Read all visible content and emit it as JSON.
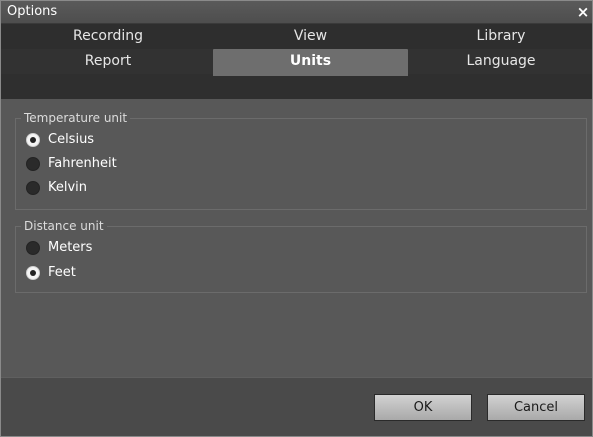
{
  "window": {
    "title": "Options",
    "close_glyph": "×"
  },
  "tabs": {
    "row1": [
      {
        "label": "Recording",
        "active": false
      },
      {
        "label": "View",
        "active": false
      },
      {
        "label": "Library",
        "active": false
      }
    ],
    "row2": [
      {
        "label": "Report",
        "active": false
      },
      {
        "label": "Units",
        "active": true
      },
      {
        "label": "Language",
        "active": false
      }
    ]
  },
  "temperature": {
    "legend": "Temperature unit",
    "options": [
      {
        "label": "Celsius",
        "checked": true
      },
      {
        "label": "Fahrenheit",
        "checked": false
      },
      {
        "label": "Kelvin",
        "checked": false
      }
    ]
  },
  "distance": {
    "legend": "Distance unit",
    "options": [
      {
        "label": "Meters",
        "checked": false
      },
      {
        "label": "Feet",
        "checked": true
      }
    ]
  },
  "buttons": {
    "ok": "OK",
    "cancel": "Cancel"
  },
  "colors": {
    "active_tab": "#6e6e6e",
    "content_bg": "#585858",
    "tab_strip_bg": "#2f2f2f"
  }
}
